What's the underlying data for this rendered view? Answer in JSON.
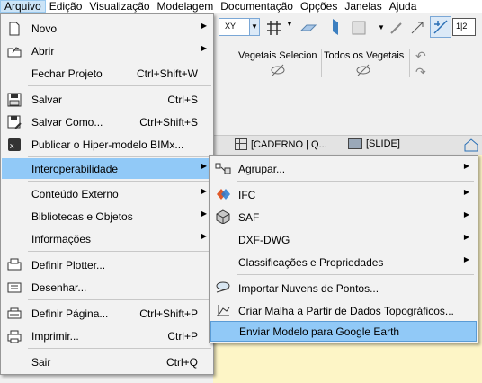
{
  "menubar": [
    "Arquivo",
    "Edição",
    "Visualização",
    "Modelagem",
    "Documentação",
    "Opções",
    "Janelas",
    "Ajuda"
  ],
  "toolbar": {
    "vegetais_selecionados": "Vegetais Selecion",
    "todos_vegetais": "Todos os Vegetais",
    "xy_label": "XY",
    "scale_label": "1|2"
  },
  "tabs": [
    "[CADERNO | Q...",
    "[SLIDE]"
  ],
  "main_menu": [
    {
      "label": "Novo",
      "arrow": "▶"
    },
    {
      "label": "Abrir",
      "arrow": "▶"
    },
    {
      "label": "Fechar Projeto",
      "shortcut": "Ctrl+Shift+W"
    },
    {
      "label": "Salvar",
      "shortcut": "Ctrl+S"
    },
    {
      "label": "Salvar Como...",
      "shortcut": "Ctrl+Shift+S"
    },
    {
      "label": "Publicar o Hiper-modelo BIMx..."
    },
    {
      "label": "Interoperabilidade",
      "arrow": "▶"
    },
    {
      "label": "Conteúdo Externo",
      "arrow": "▶"
    },
    {
      "label": "Bibliotecas e Objetos",
      "arrow": "▶"
    },
    {
      "label": "Informações",
      "arrow": "▶"
    },
    {
      "label": "Definir Plotter..."
    },
    {
      "label": "Desenhar..."
    },
    {
      "label": "Definir Página...",
      "shortcut": "Ctrl+Shift+P"
    },
    {
      "label": "Imprimir...",
      "shortcut": "Ctrl+P"
    },
    {
      "label": "Sair",
      "shortcut": "Ctrl+Q"
    }
  ],
  "submenu": [
    {
      "label": "Agrupar...",
      "arrow": "▶"
    },
    {
      "label": "IFC",
      "arrow": "▶"
    },
    {
      "label": "SAF",
      "arrow": "▶"
    },
    {
      "label": "DXF-DWG",
      "arrow": "▶"
    },
    {
      "label": "Classificações e Propriedades",
      "arrow": "▶"
    },
    {
      "label": "Importar Nuvens de Pontos..."
    },
    {
      "label": "Criar Malha a Partir de Dados Topográficos..."
    },
    {
      "label": "Enviar Modelo para Google Earth"
    }
  ],
  "colors": {
    "highlight": "#91c9f7",
    "menu_bg": "#f2f2f2",
    "canvas": "#fdf5c6"
  }
}
